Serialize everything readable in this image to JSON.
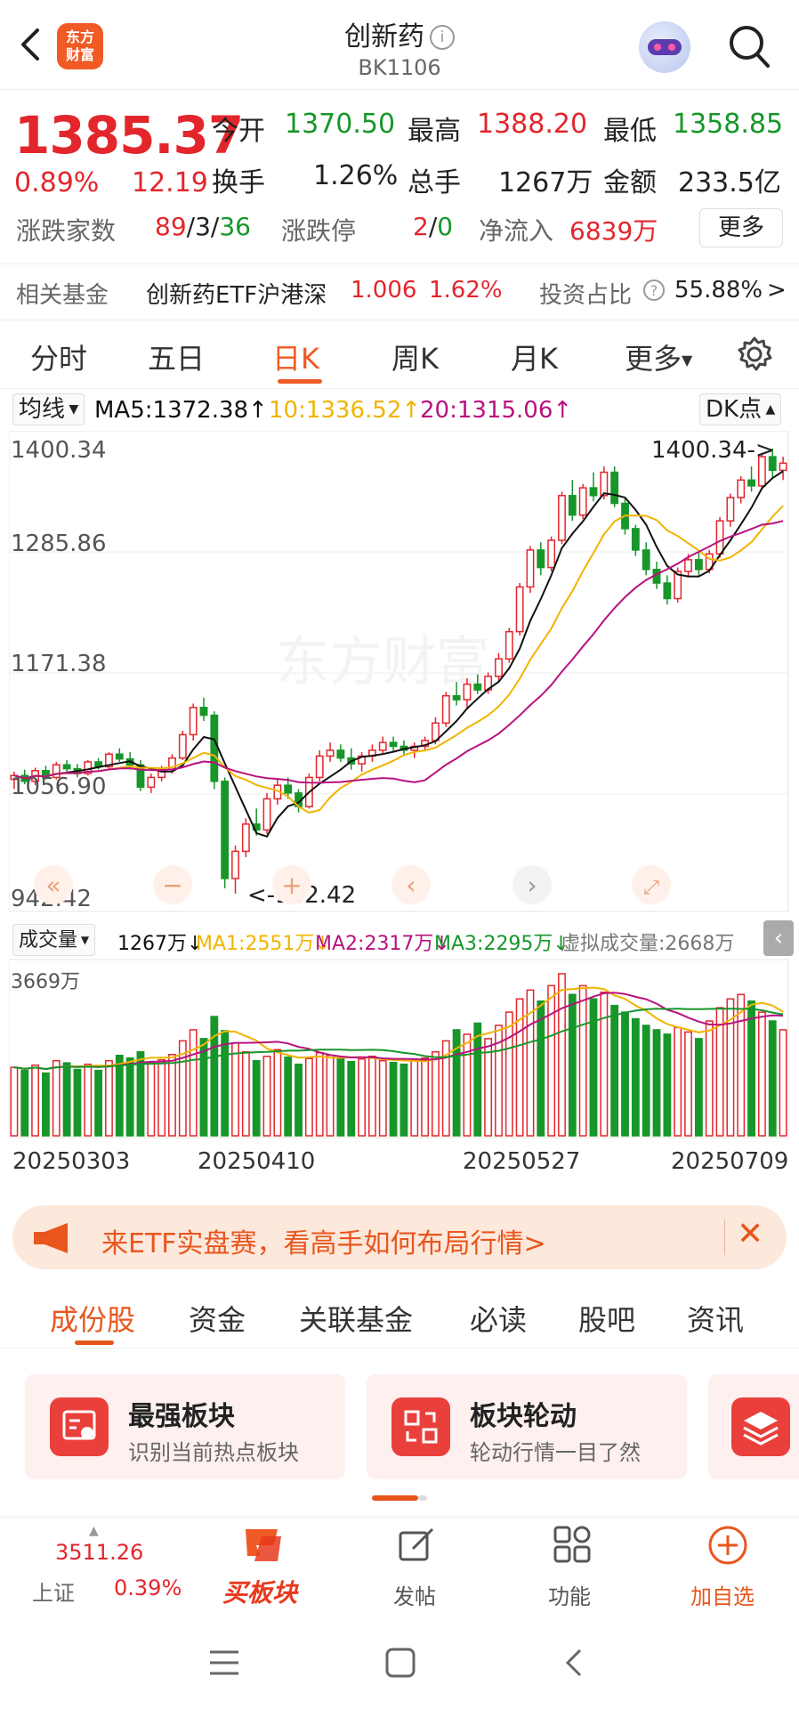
{
  "header": {
    "title": "创新药",
    "code": "BK1106",
    "logo_text_line1": "东方",
    "logo_text_line2": "财富",
    "info_icon": "i"
  },
  "quote": {
    "price": "1385.37",
    "change_pct": "0.89%",
    "change": "12.19",
    "open_label": "今开",
    "open": "1370.50",
    "high_label": "最高",
    "high": "1388.20",
    "low_label": "最低",
    "low": "1358.85",
    "turnover_label": "换手",
    "turnover": "1.26%",
    "volume_label": "总手",
    "volume": "1267万",
    "amount_label": "金额",
    "amount": "233.5亿",
    "breadth_label": "涨跌家数",
    "breadth_up": "89",
    "breadth_flat": "3",
    "breadth_down": "36",
    "slash": "/",
    "limit_label": "涨跌停",
    "limit_up": "2",
    "limit_down": "0",
    "netflow_label": "净流入",
    "netflow": "6839万",
    "more_button": "更多"
  },
  "fund_row": {
    "label": "相关基金",
    "fund_name": "创新药ETF沪港深",
    "fund_price": "1.006",
    "fund_pct": "1.62%",
    "ratio_label": "投资占比",
    "ratio_value": "55.88%",
    "chevron": ">"
  },
  "k_tabs": [
    "分时",
    "五日",
    "日K",
    "周K",
    "月K",
    "更多"
  ],
  "ma_legend": {
    "selector": "均线",
    "ma5": "MA5:1372.38↑",
    "ma10": "10:1336.52↑",
    "ma20": "20:1315.06↑",
    "dk_button": "DK点"
  },
  "price_axis": {
    "labels": [
      "1400.34",
      "1285.86",
      "1171.38",
      "1056.90",
      "942.42"
    ],
    "high_marker": "1400.34->",
    "low_marker": "<-942.42"
  },
  "volume_legend": {
    "selector": "成交量",
    "vol": "1267万↓",
    "ma1": "MA1:2551万↓",
    "ma2": "MA2:2317万↓",
    "ma3": "MA3:2295万↓",
    "virtual": "虚拟成交量:2668万",
    "max_label": "3669万"
  },
  "dates": [
    "20250303",
    "20250410",
    "20250527",
    "20250709"
  ],
  "banner": {
    "text": "来ETF实盘赛，看高手如何布局行情>"
  },
  "bottom_tabs": [
    "成份股",
    "资金",
    "关联基金",
    "必读",
    "股吧",
    "资讯"
  ],
  "cards": [
    {
      "title": "最强板块",
      "subtitle": "识别当前热点板块"
    },
    {
      "title": "板块轮动",
      "subtitle": "轮动行情一目了然"
    }
  ],
  "bottom_nav": {
    "index_value": "3511.26",
    "index_name": "上证",
    "index_pct": "0.39%",
    "buy_label": "买板块",
    "post_label": "发帖",
    "func_label": "功能",
    "add_label": "加自选"
  },
  "colors": {
    "up": "#e3262c",
    "down": "#17962a",
    "accent": "#f05a24",
    "ma5": "#111111",
    "ma10": "#f0b400",
    "ma20": "#b8127e"
  },
  "chart_data": {
    "type": "candlestick",
    "y_range": [
      942.42,
      1400.34
    ],
    "candles_ohlc": [
      [
        1060,
        1068,
        1050,
        1064
      ],
      [
        1064,
        1070,
        1055,
        1058
      ],
      [
        1058,
        1072,
        1054,
        1069
      ],
      [
        1069,
        1074,
        1060,
        1062
      ],
      [
        1062,
        1078,
        1060,
        1075
      ],
      [
        1075,
        1080,
        1068,
        1071
      ],
      [
        1071,
        1076,
        1062,
        1066
      ],
      [
        1066,
        1080,
        1064,
        1078
      ],
      [
        1078,
        1082,
        1070,
        1073
      ],
      [
        1073,
        1088,
        1071,
        1086
      ],
      [
        1086,
        1092,
        1078,
        1081
      ],
      [
        1081,
        1088,
        1070,
        1075
      ],
      [
        1075,
        1080,
        1048,
        1052
      ],
      [
        1052,
        1066,
        1046,
        1062
      ],
      [
        1062,
        1074,
        1058,
        1070
      ],
      [
        1070,
        1086,
        1066,
        1082
      ],
      [
        1082,
        1110,
        1080,
        1106
      ],
      [
        1106,
        1138,
        1100,
        1134
      ],
      [
        1134,
        1144,
        1120,
        1126
      ],
      [
        1126,
        1130,
        1050,
        1058
      ],
      [
        1058,
        1062,
        948,
        958
      ],
      [
        958,
        992,
        942.42,
        986
      ],
      [
        986,
        1020,
        980,
        1014
      ],
      [
        1014,
        1030,
        1002,
        1008
      ],
      [
        1008,
        1046,
        1004,
        1040
      ],
      [
        1040,
        1060,
        1034,
        1054
      ],
      [
        1054,
        1062,
        1040,
        1046
      ],
      [
        1046,
        1050,
        1026,
        1032
      ],
      [
        1032,
        1066,
        1030,
        1062
      ],
      [
        1062,
        1090,
        1058,
        1084
      ],
      [
        1084,
        1098,
        1078,
        1090
      ],
      [
        1090,
        1096,
        1078,
        1082
      ],
      [
        1082,
        1092,
        1070,
        1076
      ],
      [
        1076,
        1088,
        1068,
        1084
      ],
      [
        1084,
        1096,
        1078,
        1090
      ],
      [
        1090,
        1104,
        1086,
        1098
      ],
      [
        1098,
        1104,
        1088,
        1094
      ],
      [
        1094,
        1100,
        1084,
        1090
      ],
      [
        1090,
        1098,
        1082,
        1094
      ],
      [
        1094,
        1104,
        1090,
        1100
      ],
      [
        1100,
        1124,
        1096,
        1118
      ],
      [
        1118,
        1150,
        1114,
        1146
      ],
      [
        1146,
        1160,
        1136,
        1142
      ],
      [
        1142,
        1164,
        1134,
        1158
      ],
      [
        1158,
        1168,
        1148,
        1152
      ],
      [
        1152,
        1170,
        1148,
        1166
      ],
      [
        1166,
        1190,
        1160,
        1184
      ],
      [
        1184,
        1216,
        1180,
        1212
      ],
      [
        1212,
        1262,
        1208,
        1258
      ],
      [
        1258,
        1300,
        1252,
        1296
      ],
      [
        1296,
        1304,
        1270,
        1278
      ],
      [
        1278,
        1310,
        1274,
        1306
      ],
      [
        1306,
        1356,
        1302,
        1352
      ],
      [
        1352,
        1368,
        1326,
        1332
      ],
      [
        1332,
        1364,
        1328,
        1360
      ],
      [
        1360,
        1376,
        1346,
        1352
      ],
      [
        1352,
        1382,
        1348,
        1376
      ],
      [
        1376,
        1382,
        1340,
        1344
      ],
      [
        1344,
        1350,
        1312,
        1318
      ],
      [
        1318,
        1322,
        1290,
        1296
      ],
      [
        1296,
        1304,
        1270,
        1276
      ],
      [
        1276,
        1284,
        1256,
        1262
      ],
      [
        1262,
        1270,
        1240,
        1246
      ],
      [
        1246,
        1278,
        1242,
        1274
      ],
      [
        1274,
        1292,
        1268,
        1286
      ],
      [
        1286,
        1294,
        1270,
        1276
      ],
      [
        1276,
        1296,
        1272,
        1292
      ],
      [
        1292,
        1330,
        1288,
        1326
      ],
      [
        1326,
        1354,
        1320,
        1350
      ],
      [
        1350,
        1372,
        1344,
        1368
      ],
      [
        1368,
        1382,
        1356,
        1362
      ],
      [
        1362,
        1396,
        1358,
        1392
      ],
      [
        1392,
        1400.34,
        1370,
        1378
      ],
      [
        1378,
        1392,
        1368,
        1385.37
      ]
    ],
    "volume": [
      1550,
      1480,
      1600,
      1420,
      1700,
      1650,
      1500,
      1620,
      1480,
      1700,
      1820,
      1760,
      1900,
      1650,
      1720,
      1840,
      2150,
      2400,
      2200,
      2700,
      2380,
      2100,
      1900,
      1700,
      1800,
      1950,
      1780,
      1620,
      1750,
      1880,
      1820,
      1760,
      1680,
      1740,
      1800,
      1700,
      1660,
      1620,
      1700,
      1760,
      1900,
      2150,
      2400,
      2300,
      2550,
      2200,
      2500,
      2800,
      3100,
      3300,
      3050,
      3400,
      3669,
      3200,
      3400,
      3100,
      3250,
      2950,
      2800,
      2650,
      2500,
      2400,
      2300,
      2450,
      2350,
      2200,
      2600,
      2900,
      3100,
      3200,
      3050,
      2800,
      2600,
      2400
    ],
    "ylabel": "",
    "xlabel": ""
  }
}
